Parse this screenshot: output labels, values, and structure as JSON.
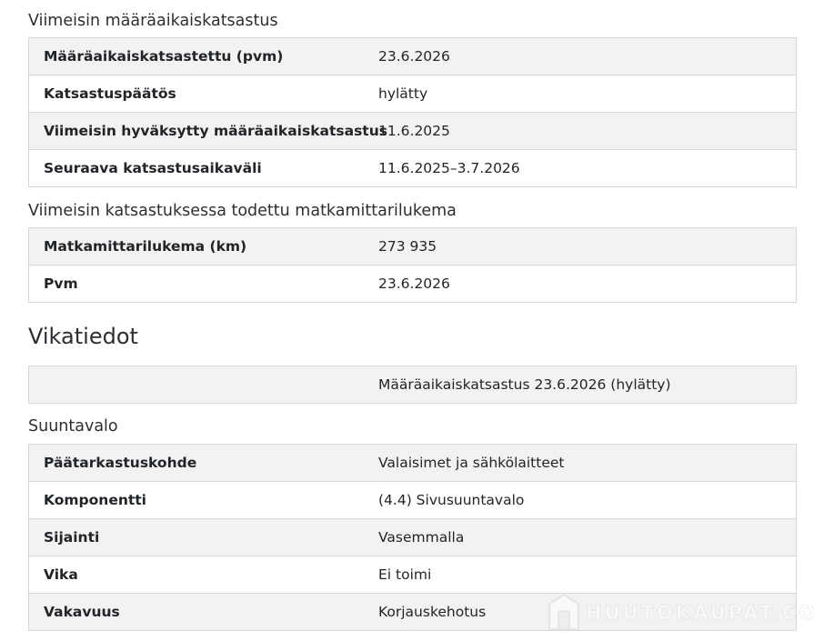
{
  "periodic_inspection": {
    "heading": "Viimeisin määräaikaiskatsastus",
    "rows": [
      {
        "label": "Määräaikaiskatsastettu (pvm)",
        "value": "23.6.2026"
      },
      {
        "label": "Katsastuspäätös",
        "value": "hylätty"
      },
      {
        "label": "Viimeisin hyväksytty määräaikaiskatsastus",
        "value": "11.6.2025"
      },
      {
        "label": "Seuraava katsastusaikaväli",
        "value": "11.6.2025–3.7.2026"
      }
    ]
  },
  "odometer": {
    "heading": "Viimeisin katsastuksessa todettu matkamittarilukema",
    "rows": [
      {
        "label": "Matkamittarilukema (km)",
        "value": "273 935"
      },
      {
        "label": "Pvm",
        "value": "23.6.2026"
      }
    ]
  },
  "faults": {
    "heading": "Vikatiedot",
    "summary_row": {
      "label": "",
      "value": "Määräaikaiskatsastus 23.6.2026 (hylätty)"
    },
    "subheading": "Suuntavalo",
    "rows": [
      {
        "label": "Päätarkastuskohde",
        "value": "Valaisimet ja sähkölaitteet"
      },
      {
        "label": "Komponentti",
        "value": "(4.4) Sivusuuntavalo"
      },
      {
        "label": "Sijainti",
        "value": "Vasemmalla"
      },
      {
        "label": "Vika",
        "value": "Ei toimi"
      },
      {
        "label": "Vakavuus",
        "value": "Korjauskehotus"
      }
    ]
  },
  "watermark": {
    "text": "HUUTOKAUPAT.COM",
    "icon": "house-logo-icon"
  }
}
